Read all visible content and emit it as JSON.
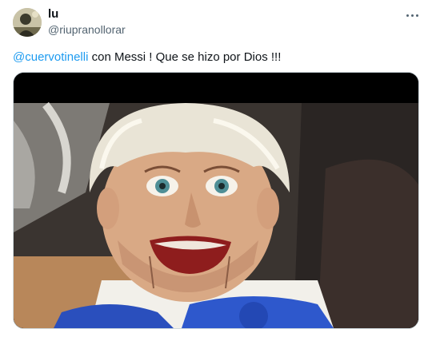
{
  "tweet": {
    "author_name": "lu",
    "author_handle": "@riupranollorar",
    "mention": "@cuervotinelli",
    "text": " con Messi ! Que se hizo por Dios !!!",
    "more_icon": "more-horizontal-icon",
    "media": {
      "kind": "photo",
      "subject": "ventriloquist-dummy"
    }
  },
  "colors": {
    "link": "#1d9bf0",
    "text": "#0f1419",
    "secondary": "#536471",
    "border": "#cfd9de"
  }
}
